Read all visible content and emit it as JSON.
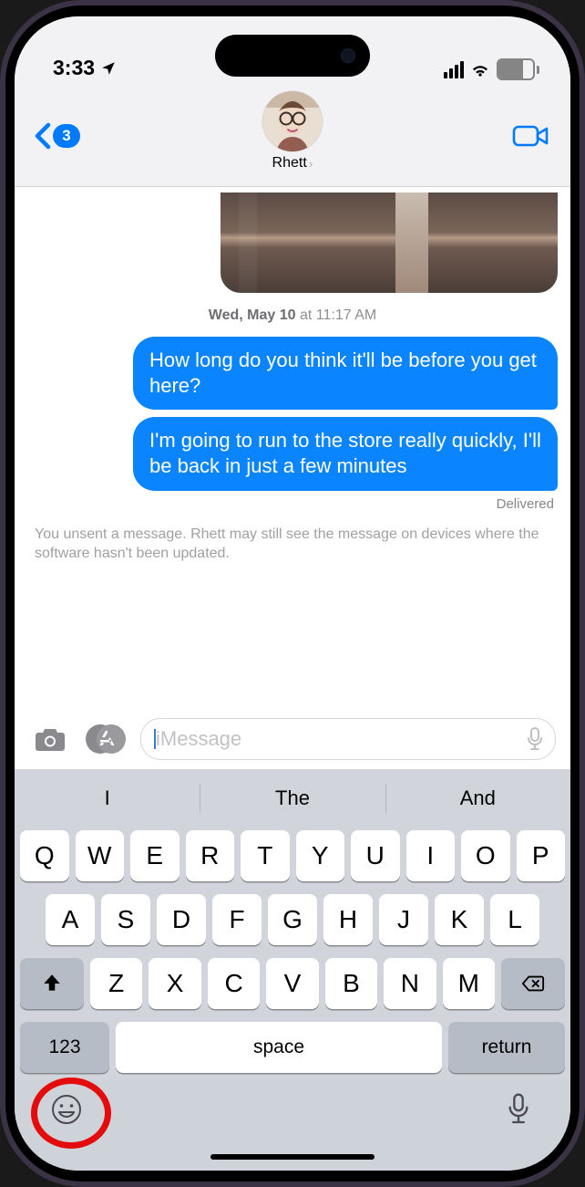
{
  "status": {
    "time": "3:33",
    "battery_pct": "70"
  },
  "header": {
    "back_badge": "3",
    "contact_name": "Rhett"
  },
  "thread": {
    "timestamp_day": "Wed, May 10",
    "timestamp_at": " at ",
    "timestamp_time": "11:17 AM",
    "msg1": "How long do you think it'll be before you get here?",
    "msg2": "I'm going to run to the store really quickly, I'll be back in just a few minutes",
    "delivered": "Delivered",
    "unsent_notice": "You unsent a message. Rhett may still see the message on devices where the software hasn't been updated."
  },
  "compose": {
    "placeholder": "iMessage"
  },
  "keyboard": {
    "predictions": [
      "I",
      "The",
      "And"
    ],
    "row1": [
      "Q",
      "W",
      "E",
      "R",
      "T",
      "Y",
      "U",
      "I",
      "O",
      "P"
    ],
    "row2": [
      "A",
      "S",
      "D",
      "F",
      "G",
      "H",
      "J",
      "K",
      "L"
    ],
    "row3": [
      "Z",
      "X",
      "C",
      "V",
      "B",
      "N",
      "M"
    ],
    "numkey": "123",
    "space": "space",
    "return": "return"
  }
}
